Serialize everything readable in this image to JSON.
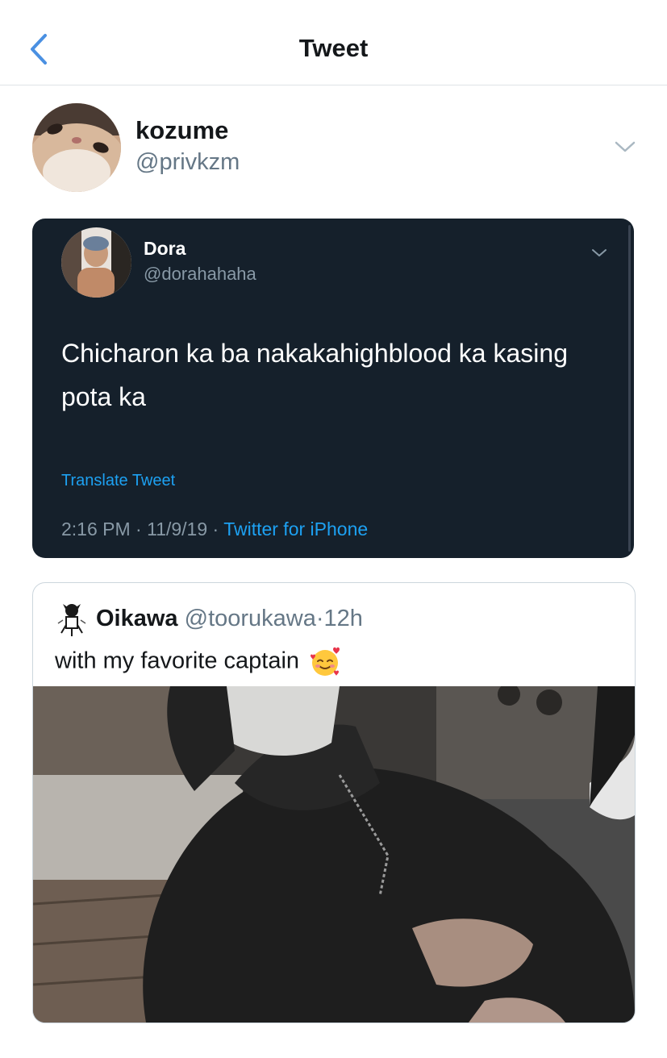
{
  "header": {
    "title": "Tweet",
    "back_icon": "chevron-left-icon"
  },
  "tweet": {
    "author_name": "kozume",
    "author_handle": "@privkzm",
    "menu_icon": "chevron-down-icon"
  },
  "screenshot_card": {
    "author_name": "Dora",
    "author_handle": "@dorahahaha",
    "text": "Chicharon ka ba nakakahighblood ka kasing pota ka",
    "translate_label": "Translate Tweet",
    "time": "2:16 PM",
    "date": "11/9/19",
    "separator": "·",
    "source": "Twitter for iPhone"
  },
  "quoted_tweet": {
    "author_name": "Oikawa",
    "author_handle": "@toorukawa",
    "separator": "·",
    "time": "12h",
    "text": "with my favorite captain",
    "emoji_icon": "smiling-face-with-hearts-icon"
  },
  "colors": {
    "accent": "#1da1f2",
    "back_blue": "#4a90e2",
    "dark_card_bg": "#15202b",
    "secondary_text": "#657786"
  }
}
